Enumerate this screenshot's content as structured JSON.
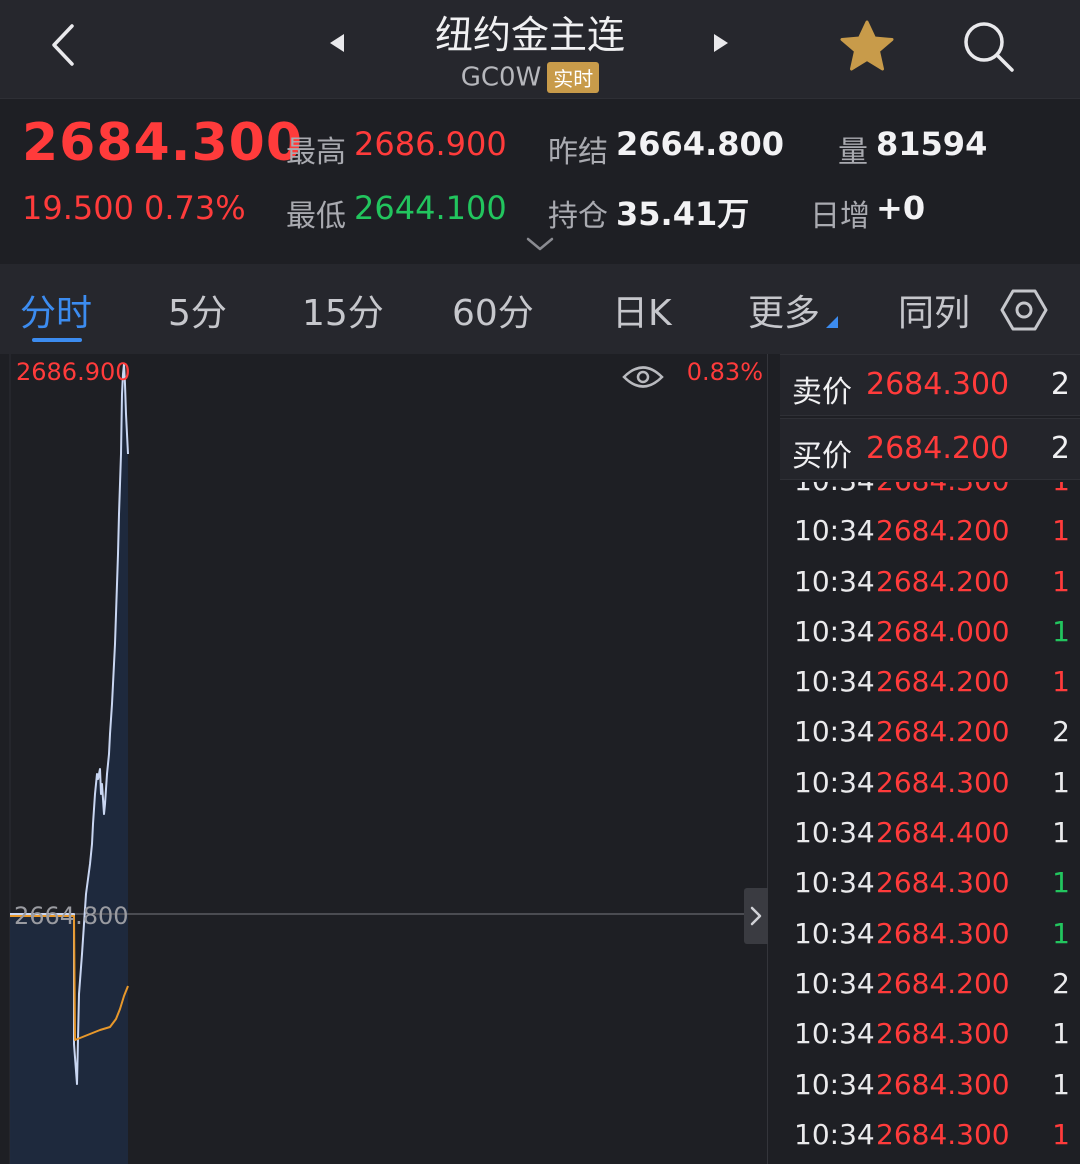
{
  "header": {
    "title": "纽约金主连",
    "code": "GC0W",
    "realtime_badge": "实时"
  },
  "quote": {
    "last_price": "2684.300",
    "change": "19.500",
    "change_pct": "0.73%",
    "high_label": "最高",
    "high": "2686.900",
    "low_label": "最低",
    "low": "2644.100",
    "prev_settle_label": "昨结",
    "prev_settle": "2664.800",
    "open_interest_label": "持仓",
    "open_interest": "35.41万",
    "volume_label": "量",
    "volume": "81594",
    "daily_increase_label": "日增",
    "daily_increase": "+0"
  },
  "tabs": [
    "分时",
    "5分",
    "15分",
    "60分",
    "日K",
    "更多",
    "同列"
  ],
  "active_tab": "分时",
  "chart": {
    "high_label": "2686.900",
    "pct_label": "0.83%",
    "base_label": "2664.800"
  },
  "orderbook": {
    "ask_label": "卖价",
    "ask_price": "2684.300",
    "ask_qty": "2",
    "bid_label": "买价",
    "bid_price": "2684.200",
    "bid_qty": "2"
  },
  "ticks": [
    {
      "time": "10:34",
      "price": "2684.300",
      "vol": "1",
      "dir": "red"
    },
    {
      "time": "10:34",
      "price": "2684.200",
      "vol": "1",
      "dir": "red"
    },
    {
      "time": "10:34",
      "price": "2684.200",
      "vol": "1",
      "dir": "red"
    },
    {
      "time": "10:34",
      "price": "2684.000",
      "vol": "1",
      "dir": "green"
    },
    {
      "time": "10:34",
      "price": "2684.200",
      "vol": "1",
      "dir": "red"
    },
    {
      "time": "10:34",
      "price": "2684.200",
      "vol": "2",
      "dir": "white"
    },
    {
      "time": "10:34",
      "price": "2684.300",
      "vol": "1",
      "dir": "white"
    },
    {
      "time": "10:34",
      "price": "2684.400",
      "vol": "1",
      "dir": "white"
    },
    {
      "time": "10:34",
      "price": "2684.300",
      "vol": "1",
      "dir": "green"
    },
    {
      "time": "10:34",
      "price": "2684.300",
      "vol": "1",
      "dir": "green"
    },
    {
      "time": "10:34",
      "price": "2684.200",
      "vol": "2",
      "dir": "white"
    },
    {
      "time": "10:34",
      "price": "2684.300",
      "vol": "1",
      "dir": "white"
    },
    {
      "time": "10:34",
      "price": "2684.300",
      "vol": "1",
      "dir": "white"
    },
    {
      "time": "10:34",
      "price": "2684.300",
      "vol": "1",
      "dir": "red"
    }
  ],
  "colors": {
    "up": "#ff3b3b",
    "down": "#22c55e",
    "accent": "#3c8cf0",
    "price_line": "#c9d6f2",
    "avg_line": "#e8982b",
    "star": "#c89b4a"
  }
}
